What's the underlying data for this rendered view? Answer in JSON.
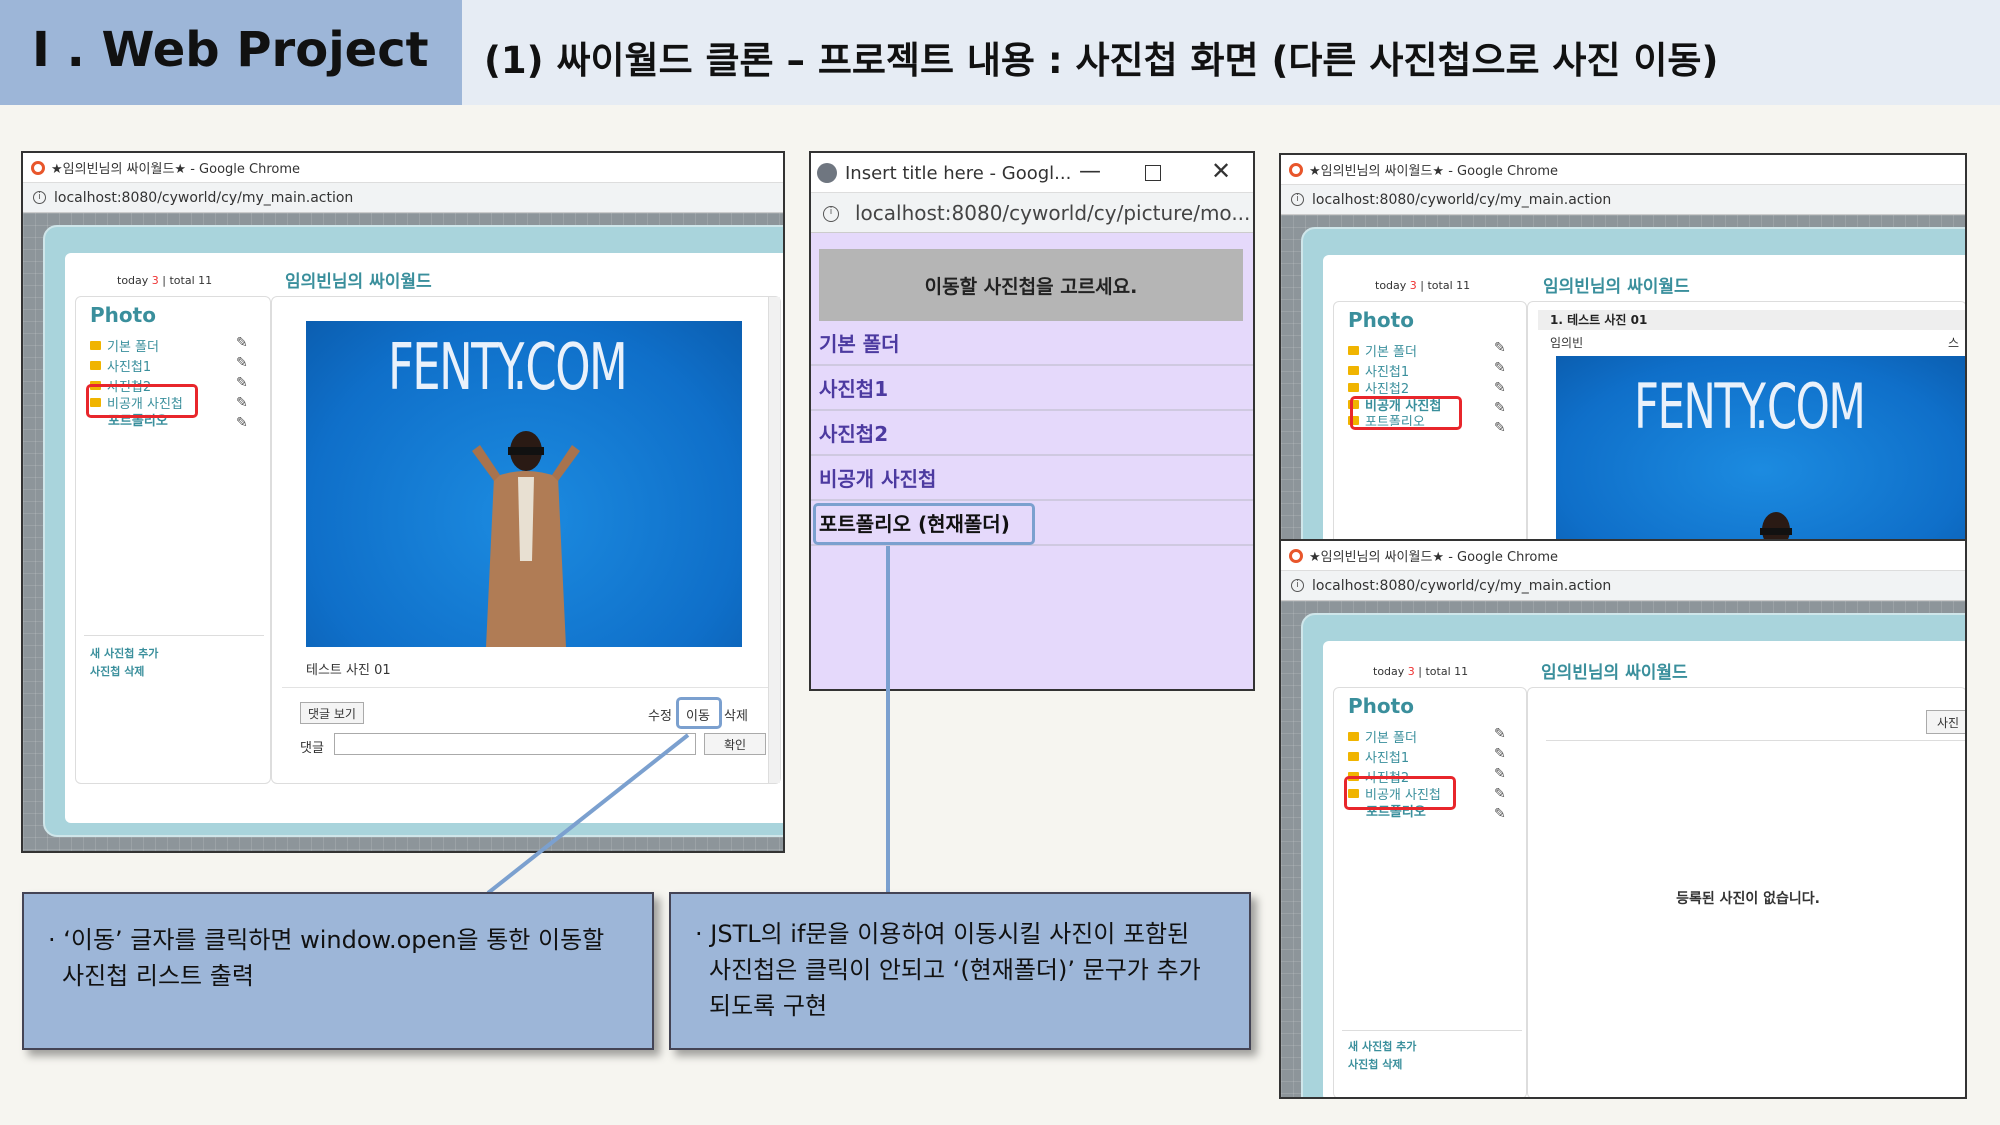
{
  "header": {
    "title": "I . Web Project",
    "subtitle": "(1) 싸이월드 클론 – 프로젝트 내용 : 사진첩 화면 (다른 사진첩으로 사진 이동)"
  },
  "colors": {
    "header_left": "#9db6d8",
    "header_right": "#e6ecf4",
    "cy_teal": "#3a8f9c",
    "highlight_red": "#e8262b",
    "highlight_blue": "#7ba0cf",
    "popup_bg": "#e5d9fb"
  },
  "win1": {
    "title": "★임의빈님의 싸이월드★ - Google Chrome",
    "url": "localhost:8080/cyworld/cy/my_main.action",
    "today_label": "today",
    "today_count": "3",
    "total_label": "| total 11",
    "cy_title": "임의빈님의 싸이월드",
    "photo": "Photo",
    "folders": [
      "기본 폴더",
      "사진첩1",
      "사진첩2",
      "비공개 사진첩",
      "포트폴리오"
    ],
    "side_links": [
      "새 사진첩 추가",
      "사진첩 삭제"
    ],
    "image_text": "FENTY.COM",
    "caption": "테스트 사진 01",
    "comment_toggle": "댓글 보기",
    "edit": "수정",
    "move": "이동",
    "delete": "삭제",
    "comment_label": "댓글",
    "confirm": "확인"
  },
  "popup": {
    "title": "Insert title here - Googl...",
    "url": "localhost:8080/cyworld/cy/picture/mo...",
    "heading": "이동할 사진첩을 고르세요.",
    "items": [
      "기본 폴더",
      "사진첩1",
      "사진첩2",
      "비공개 사진첩",
      "포트폴리오 (현재폴더)"
    ]
  },
  "win2": {
    "title": "★임의빈님의 싸이월드★ - Google Chrome",
    "url": "localhost:8080/cyworld/cy/my_main.action",
    "today_label": "today",
    "today_count": "3",
    "total_label": "| total 11",
    "cy_title": "임의빈님의 싸이월드",
    "photo": "Photo",
    "folders": [
      "기본 폴더",
      "사진첩1",
      "사진첩2",
      "비공개 사진첩",
      "포트폴리오"
    ],
    "post_title": "1. 테스트 사진 01",
    "author": "임의빈",
    "author_right": "스",
    "image_text": "FENTY.COM"
  },
  "win3": {
    "title": "★임의빈님의 싸이월드★ - Google Chrome",
    "url": "localhost:8080/cyworld/cy/my_main.action",
    "today_label": "today",
    "today_count": "3",
    "total_label": "| total 11",
    "cy_title": "임의빈님의 싸이월드",
    "photo": "Photo",
    "folders": [
      "기본 폴더",
      "사진첩1",
      "사진첩2",
      "비공개 사진첩",
      "포트폴리오"
    ],
    "side_links": [
      "새 사진첩 추가",
      "사진첩 삭제"
    ],
    "top_button": "사진",
    "empty_msg": "등록된 사진이 없습니다."
  },
  "callouts": [
    {
      "line1": "· ‘이동’ 글자를 클릭하면 window.open을 통한 이동할",
      "line2": "사진첩 리스트 출력"
    },
    {
      "line1": "· JSTL의 if문을 이용하여 이동시킬 사진이 포함된",
      "line2": "사진첩은 클릭이 안되고 ‘(현재폴더)’ 문구가 추가",
      "line3": "되도록 구현"
    }
  ]
}
